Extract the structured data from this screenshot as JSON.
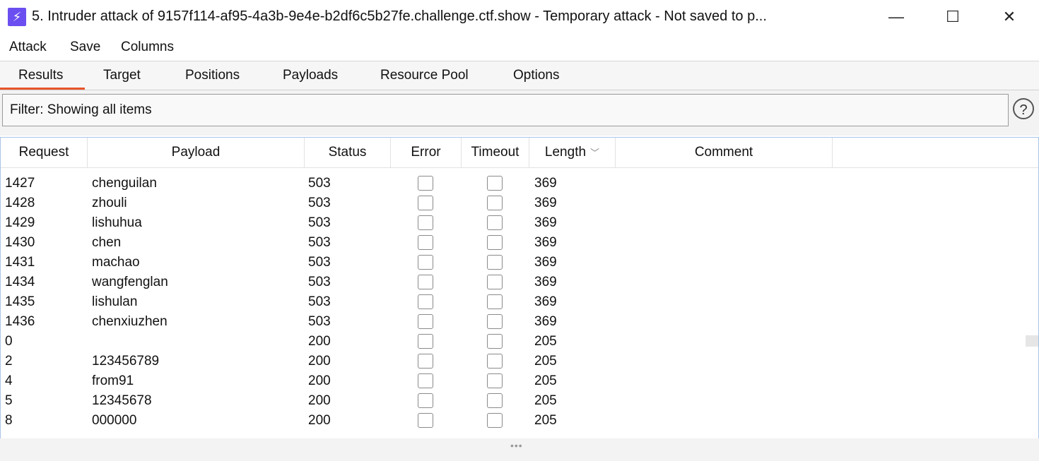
{
  "window": {
    "title": "5. Intruder attack of 9157f114-af95-4a3b-9e4e-b2df6c5b27fe.challenge.ctf.show - Temporary attack - Not saved to p...",
    "app_icon_glyph": "⚡",
    "minimize_glyph": "—",
    "maximize_glyph": "☐",
    "close_glyph": "✕"
  },
  "menu": {
    "attack": "Attack",
    "save": "Save",
    "columns": "Columns"
  },
  "tabs": {
    "results": "Results",
    "target": "Target",
    "positions": "Positions",
    "payloads": "Payloads",
    "resource_pool": "Resource Pool",
    "options": "Options",
    "active": "Results",
    "accent_color": "#e8542a"
  },
  "filter": {
    "text": "Filter: Showing all items",
    "help_glyph": "?"
  },
  "table": {
    "headers": {
      "request": "Request",
      "payload": "Payload",
      "status": "Status",
      "error": "Error",
      "timeout": "Timeout",
      "length": "Length",
      "comment": "Comment"
    },
    "sort_glyph": "﹀",
    "rows": [
      {
        "request": "1427",
        "payload": "chenguilan",
        "status": "503",
        "length": "369"
      },
      {
        "request": "1428",
        "payload": "zhouli",
        "status": "503",
        "length": "369"
      },
      {
        "request": "1429",
        "payload": "lishuhua",
        "status": "503",
        "length": "369"
      },
      {
        "request": "1430",
        "payload": "chen",
        "status": "503",
        "length": "369"
      },
      {
        "request": "1431",
        "payload": "machao",
        "status": "503",
        "length": "369"
      },
      {
        "request": "1434",
        "payload": "wangfenglan",
        "status": "503",
        "length": "369"
      },
      {
        "request": "1435",
        "payload": "lishulan",
        "status": "503",
        "length": "369"
      },
      {
        "request": "1436",
        "payload": "chenxiuzhen",
        "status": "503",
        "length": "369"
      },
      {
        "request": "0",
        "payload": "",
        "status": "200",
        "length": "205"
      },
      {
        "request": "2",
        "payload": "123456789",
        "status": "200",
        "length": "205"
      },
      {
        "request": "4",
        "payload": "from91",
        "status": "200",
        "length": "205"
      },
      {
        "request": "5",
        "payload": "12345678",
        "status": "200",
        "length": "205"
      },
      {
        "request": "8",
        "payload": "000000",
        "status": "200",
        "length": "205"
      }
    ]
  },
  "splitter": {
    "grip_glyph": "•••"
  }
}
